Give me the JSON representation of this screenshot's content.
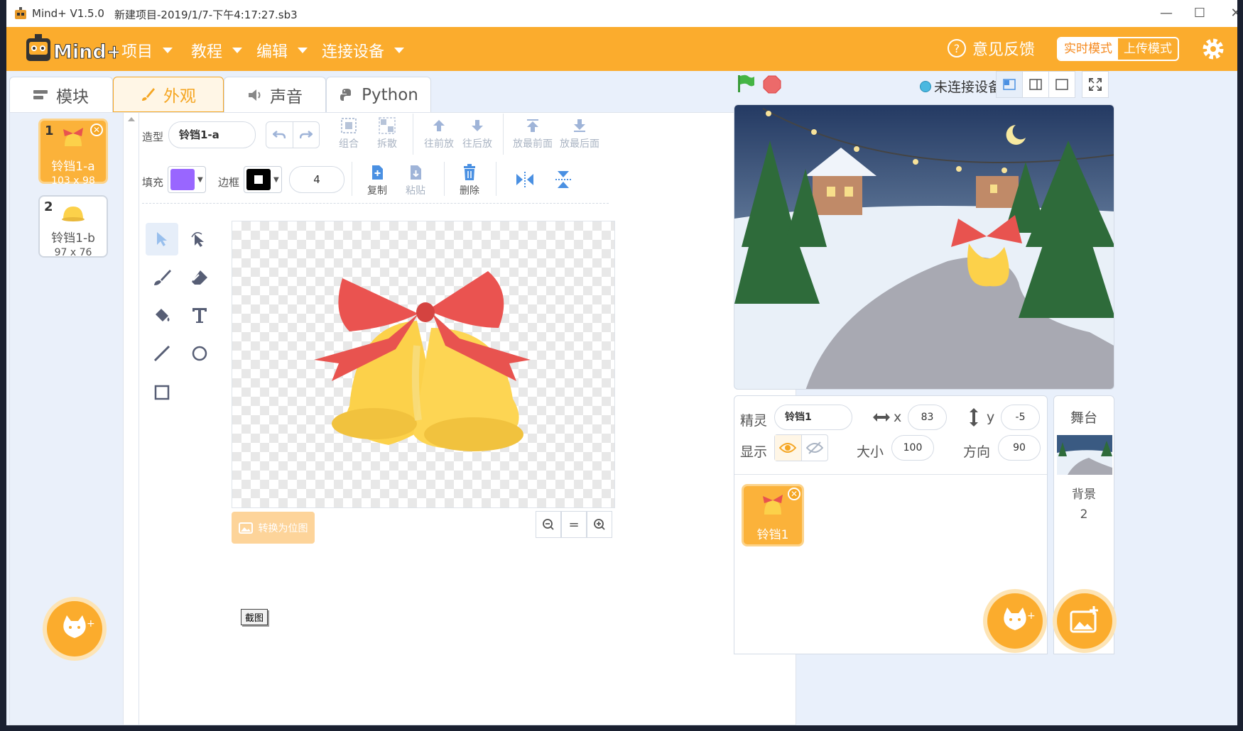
{
  "titlebar": {
    "app": "Mind+ V1.5.0",
    "file": "新建项目-2019/1/7-下午4:17:27.sb3",
    "minimize": "—",
    "maximize": "☐",
    "close": "✕"
  },
  "menubar": {
    "logo_text": "Mind+",
    "menus": [
      "项目",
      "教程",
      "编辑",
      "连接设备"
    ],
    "feedback": "意见反馈",
    "mode_realtime": "实时模式",
    "mode_upload": "上传模式"
  },
  "tabs": [
    "模块",
    "外观",
    "声音",
    "Python"
  ],
  "costumes": [
    {
      "num": "1",
      "name": "铃铛1-a",
      "size": "103 x 98"
    },
    {
      "num": "2",
      "name": "铃铛1-b",
      "size": "97 x 76"
    }
  ],
  "editor": {
    "costume_label": "造型",
    "costume_name": "铃铛1-a",
    "group": "组合",
    "ungroup": "拆散",
    "forward": "往前放",
    "backward": "往后放",
    "front": "放最前面",
    "back": "放最后面",
    "fill_label": "填充",
    "outline_label": "边框",
    "outline_width": "4",
    "copy": "复制",
    "paste": "粘贴",
    "delete": "删除",
    "bitmap": "转换为位图",
    "zoom_reset": "="
  },
  "tooltip": "截图",
  "stage_header": {
    "connection": "未连接设备"
  },
  "sprite_info": {
    "sprite_label": "精灵",
    "sprite_name": "铃铛1",
    "x_label": "x",
    "x": "83",
    "y_label": "y",
    "y": "-5",
    "show_label": "显示",
    "size_label": "大小",
    "size": "100",
    "direction_label": "方向",
    "direction": "90"
  },
  "sprites": [
    {
      "name": "铃铛1"
    }
  ],
  "stage_panel": {
    "title": "舞台",
    "backdrop_label": "背景",
    "backdrop_count": "2"
  },
  "colors": {
    "accent": "#fbac2d",
    "fill": "#9966ff",
    "outline": "#000000",
    "active_tab": "#f5a623"
  }
}
